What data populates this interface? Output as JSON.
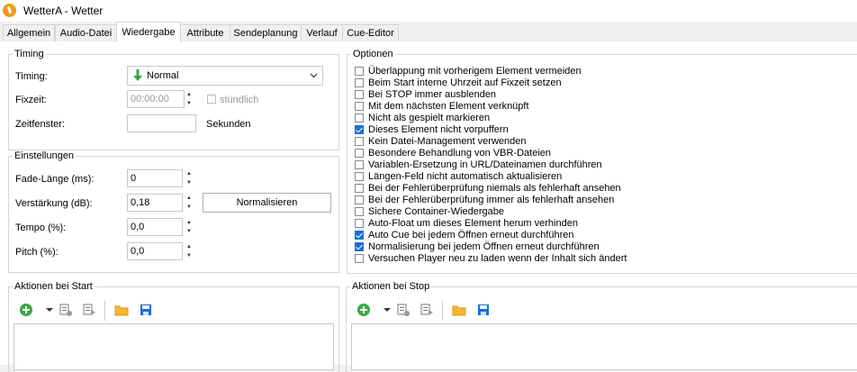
{
  "window": {
    "title": "WetterA - Wetter"
  },
  "tabs": [
    {
      "label": "Allgemein"
    },
    {
      "label": "Audio-Datei"
    },
    {
      "label": "Wiedergabe"
    },
    {
      "label": "Attribute"
    },
    {
      "label": "Sendeplanung"
    },
    {
      "label": "Verlauf"
    },
    {
      "label": "Cue-Editor"
    }
  ],
  "timing": {
    "group_label": "Timing",
    "timing_label": "Timing:",
    "timing_value": "Normal",
    "fixzeit_label": "Fixzeit:",
    "fixzeit_value": "00:00:00",
    "stuendlich_label": "stündlich",
    "zeitfenster_label": "Zeitfenster:",
    "zeitfenster_value": "",
    "sekunden_label": "Sekunden"
  },
  "einstellungen": {
    "group_label": "Einstellungen",
    "fade_label": "Fade-Länge (ms):",
    "fade_value": "0",
    "verst_label": "Verstärkung (dB):",
    "verst_value": "0,18",
    "normalisieren_label": "Normalisieren",
    "tempo_label": "Tempo (%):",
    "tempo_value": "0,0",
    "pitch_label": "Pitch (%):",
    "pitch_value": "0,0"
  },
  "optionen": {
    "group_label": "Optionen",
    "items": [
      {
        "label": "Überlappung mit vorherigem Element vermeiden",
        "checked": false
      },
      {
        "label": "Beim Start interne Uhrzeit auf Fixzeit setzen",
        "checked": false
      },
      {
        "label": "Bei STOP immer ausblenden",
        "checked": false
      },
      {
        "label": "Mit dem nächsten Element verknüpft",
        "checked": false
      },
      {
        "label": "Nicht als gespielt markieren",
        "checked": false
      },
      {
        "label": "Dieses Element nicht vorpuffern",
        "checked": true
      },
      {
        "label": "Kein Datei-Management verwenden",
        "checked": false
      },
      {
        "label": "Besondere Behandlung von VBR-Dateien",
        "checked": false
      },
      {
        "label": "Variablen-Ersetzung in URL/Dateinamen durchführen",
        "checked": false
      },
      {
        "label": "Längen-Feld nicht automatisch aktualisieren",
        "checked": false
      },
      {
        "label": "Bei der Fehlerüberprüfung niemals als fehlerhaft ansehen",
        "checked": false
      },
      {
        "label": "Bei der Fehlerüberprüfung immer als fehlerhaft ansehen",
        "checked": false
      },
      {
        "label": "Sichere Container-Wiedergabe",
        "checked": false
      },
      {
        "label": "Auto-Float um dieses Element herum verhinden",
        "checked": false
      },
      {
        "label": "Auto Cue bei jedem Öffnen erneut durchführen",
        "checked": true
      },
      {
        "label": "Normalisierung bei jedem Öffnen erneut durchführen",
        "checked": true
      },
      {
        "label": "Versuchen Player neu zu laden wenn der Inhalt sich ändert",
        "checked": false
      }
    ]
  },
  "aktionen_start": {
    "group_label": "Aktionen bei Start"
  },
  "aktionen_stop": {
    "group_label": "Aktionen bei Stop"
  },
  "icons": {
    "add": "plus-circle-icon",
    "dropdown": "chevron-down-icon",
    "edit_list": "list-edit-icon",
    "run": "list-run-icon",
    "open": "folder-icon",
    "save": "floppy-disk-icon"
  },
  "colors": {
    "accent": "#1a6fd4",
    "green": "#3aa845",
    "app_icon": "#f39a1b"
  }
}
